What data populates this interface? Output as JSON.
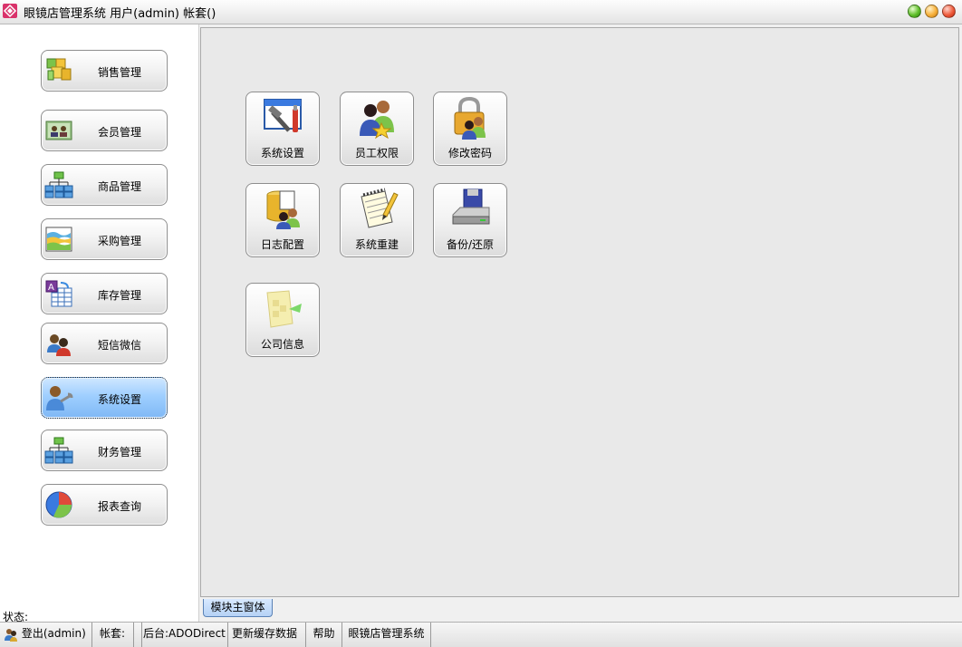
{
  "window": {
    "title": "眼镜店管理系统 用户(admin) 帐套()"
  },
  "sidebar": {
    "items": [
      {
        "label": "销售管理",
        "icon": "cubes-icon",
        "active": false
      },
      {
        "label": "会员管理",
        "icon": "members-card-icon",
        "active": false
      },
      {
        "label": "商品管理",
        "icon": "org-chart-icon",
        "active": false
      },
      {
        "label": "采购管理",
        "icon": "purchase-chart-icon",
        "active": false
      },
      {
        "label": "库存管理",
        "icon": "inventory-table-icon",
        "active": false
      },
      {
        "label": "短信微信",
        "icon": "users-sms-icon",
        "active": false
      },
      {
        "label": "系统设置",
        "icon": "user-wrench-icon",
        "active": true
      },
      {
        "label": "财务管理",
        "icon": "org-chart-icon",
        "active": false
      },
      {
        "label": "报表查询",
        "icon": "pie-chart-icon",
        "active": false
      }
    ],
    "status_label": "状态:"
  },
  "main": {
    "tiles": [
      {
        "label": "系统设置",
        "icon": "tools-window-icon"
      },
      {
        "label": "员工权限",
        "icon": "staff-users-icon"
      },
      {
        "label": "修改密码",
        "icon": "padlock-user-icon"
      },
      {
        "label": "日志配置",
        "icon": "database-users-icon"
      },
      {
        "label": "系统重建",
        "icon": "notepad-pencil-icon"
      },
      {
        "label": "备份/还原",
        "icon": "disk-drive-icon"
      },
      {
        "label": "公司信息",
        "icon": "company-info-icon"
      }
    ],
    "tab_label": "模块主窗体"
  },
  "statusbar": {
    "login": "登出(admin)",
    "account": "帐套:",
    "blank": "",
    "backend": "后台:ADODirect",
    "refresh": "更新缓存数据",
    "help": "帮助",
    "app_name": "眼镜店管理系统"
  },
  "colors": {
    "active_button": "#9fcfff",
    "main_background": "#e9e9e9",
    "sidebar_background": "#ffffff"
  }
}
